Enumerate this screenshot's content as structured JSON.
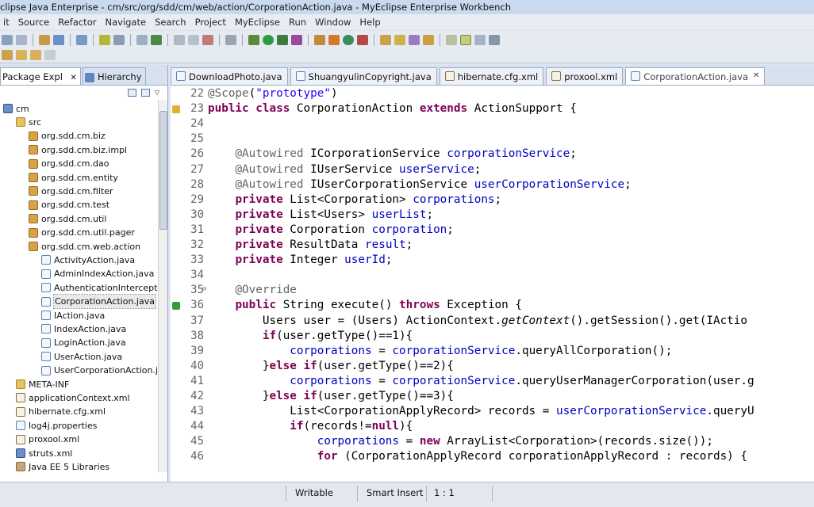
{
  "window": {
    "title": "clipse Java Enterprise - cm/src/org/sdd/cm/web/action/CorporationAction.java - MyEclipse Enterprise Workbench"
  },
  "menu": [
    "it",
    "Source",
    "Refactor",
    "Navigate",
    "Search",
    "Project",
    "MyEclipse",
    "Run",
    "Window",
    "Help"
  ],
  "left_panel": {
    "tabs": [
      {
        "label": "Package Expl",
        "close": "✕"
      },
      {
        "label": "Hierarchy"
      }
    ],
    "tree": [
      {
        "label": "cm",
        "icon": "project-icon",
        "depth": 0
      },
      {
        "label": "src",
        "icon": "folder-icon",
        "depth": 1
      },
      {
        "label": "org.sdd.cm.biz",
        "icon": "package-icon",
        "depth": 2
      },
      {
        "label": "org.sdd.cm.biz.impl",
        "icon": "package-icon",
        "depth": 2
      },
      {
        "label": "org.sdd.cm.dao",
        "icon": "package-icon",
        "depth": 2
      },
      {
        "label": "org.sdd.cm.entity",
        "icon": "package-icon",
        "depth": 2
      },
      {
        "label": "org.sdd.cm.filter",
        "icon": "package-icon",
        "depth": 2
      },
      {
        "label": "org.sdd.cm.test",
        "icon": "package-icon",
        "depth": 2
      },
      {
        "label": "org.sdd.cm.util",
        "icon": "package-icon",
        "depth": 2
      },
      {
        "label": "org.sdd.cm.util.pager",
        "icon": "package-icon",
        "depth": 2
      },
      {
        "label": "org.sdd.cm.web.action",
        "icon": "package-icon",
        "depth": 2
      },
      {
        "label": "ActivityAction.java",
        "icon": "java-file-icon",
        "depth": 3
      },
      {
        "label": "AdminIndexAction.java",
        "icon": "java-file-icon",
        "depth": 3
      },
      {
        "label": "AuthenticationIntercepto",
        "icon": "java-file-icon",
        "depth": 3
      },
      {
        "label": "CorporationAction.java",
        "icon": "java-file-icon",
        "depth": 3,
        "selected": true
      },
      {
        "label": "IAction.java",
        "icon": "java-file-icon",
        "depth": 3
      },
      {
        "label": "IndexAction.java",
        "icon": "java-file-icon",
        "depth": 3
      },
      {
        "label": "LoginAction.java",
        "icon": "java-file-icon",
        "depth": 3
      },
      {
        "label": "UserAction.java",
        "icon": "java-file-icon",
        "depth": 3
      },
      {
        "label": "UserCorporationAction.j",
        "icon": "java-file-icon",
        "depth": 3
      },
      {
        "label": "META-INF",
        "icon": "folder-icon",
        "depth": 1
      },
      {
        "label": "applicationContext.xml",
        "icon": "xml-file-icon",
        "depth": 1
      },
      {
        "label": "hibernate.cfg.xml",
        "icon": "xml-file-icon",
        "depth": 1
      },
      {
        "label": "log4j.properties",
        "icon": "properties-file-icon",
        "depth": 1
      },
      {
        "label": "proxool.xml",
        "icon": "xml-file-icon",
        "depth": 1
      },
      {
        "label": "struts.xml",
        "icon": "gear-icon",
        "depth": 1
      },
      {
        "label": "Java EE 5 Libraries",
        "icon": "library-icon",
        "depth": 1
      }
    ]
  },
  "editor": {
    "tabs": [
      {
        "label": "DownloadPhoto.java",
        "active": false
      },
      {
        "label": "ShuangyulinCopyright.java",
        "active": false
      },
      {
        "label": "hibernate.cfg.xml",
        "active": false
      },
      {
        "label": "proxool.xml",
        "active": false
      },
      {
        "label": "CorporationAction.java",
        "active": true,
        "close": "✕"
      }
    ],
    "lines": [
      {
        "n": "22",
        "html": "<span class=\"an\">@Scope</span>(<span class=\"st\">\"prototype\"</span>)"
      },
      {
        "n": "23",
        "html": "<span class=\"kw\">public</span> <span class=\"kw\">class</span> CorporationAction <span class=\"kw\">extends</span> ActionSupport {"
      },
      {
        "n": "24",
        "html": ""
      },
      {
        "n": "25",
        "html": ""
      },
      {
        "n": "26",
        "html": "    <span class=\"an\">@Autowired</span> ICorporationService <span class=\"fd\">corporationService</span>;"
      },
      {
        "n": "27",
        "html": "    <span class=\"an\">@Autowired</span> IUserService <span class=\"fd\">userService</span>;"
      },
      {
        "n": "28",
        "html": "    <span class=\"an\">@Autowired</span> IUserCorporationService <span class=\"fd\">userCorporationService</span>;"
      },
      {
        "n": "29",
        "html": "    <span class=\"kw\">private</span> List&lt;Corporation&gt; <span class=\"fd\">corporations</span>;"
      },
      {
        "n": "30",
        "html": "    <span class=\"kw\">private</span> List&lt;Users&gt; <span class=\"fd\">userList</span>;"
      },
      {
        "n": "31",
        "html": "    <span class=\"kw\">private</span> Corporation <span class=\"fd\">corporation</span>;"
      },
      {
        "n": "32",
        "html": "    <span class=\"kw\">private</span> ResultData <span class=\"fd\">result</span>;"
      },
      {
        "n": "33",
        "html": "    <span class=\"kw\">private</span> Integer <span class=\"fd\">userId</span>;"
      },
      {
        "n": "34",
        "html": ""
      },
      {
        "n": "35",
        "html": "    <span class=\"an\">@Override</span>"
      },
      {
        "n": "36",
        "html": "    <span class=\"kw\">public</span> String execute() <span class=\"kw\">throws</span> Exception {"
      },
      {
        "n": "37",
        "html": "        Users user = (Users) ActionContext.<span class=\"it\">getContext</span>().getSession().get(IActio"
      },
      {
        "n": "38",
        "html": "        <span class=\"kw\">if</span>(user.getType()==1){"
      },
      {
        "n": "39",
        "html": "            <span class=\"fd\">corporations</span> = <span class=\"fd\">corporationService</span>.queryAllCorporation();"
      },
      {
        "n": "40",
        "html": "        }<span class=\"kw\">else</span> <span class=\"kw\">if</span>(user.getType()==2){"
      },
      {
        "n": "41",
        "html": "            <span class=\"fd\">corporations</span> = <span class=\"fd\">corporationService</span>.queryUserManagerCorporation(user.g"
      },
      {
        "n": "42",
        "html": "        }<span class=\"kw\">else</span> <span class=\"kw\">if</span>(user.getType()==3){"
      },
      {
        "n": "43",
        "html": "            List&lt;CorporationApplyRecord&gt; records = <span class=\"fd\">userCorporationService</span>.queryU"
      },
      {
        "n": "44",
        "html": "            <span class=\"kw\">if</span>(records!=<span class=\"kw\">null</span>){"
      },
      {
        "n": "45",
        "html": "                <span class=\"fd\">corporations</span> = <span class=\"kw\">new</span> ArrayList&lt;Corporation&gt;(records.size());"
      },
      {
        "n": "46",
        "html": "                <span class=\"kw\">for</span> (CorporationApplyRecord corporationApplyRecord : records) {"
      }
    ]
  },
  "status": {
    "writable": "Writable",
    "insert_mode": "Smart Insert",
    "position": "1 : 1"
  }
}
